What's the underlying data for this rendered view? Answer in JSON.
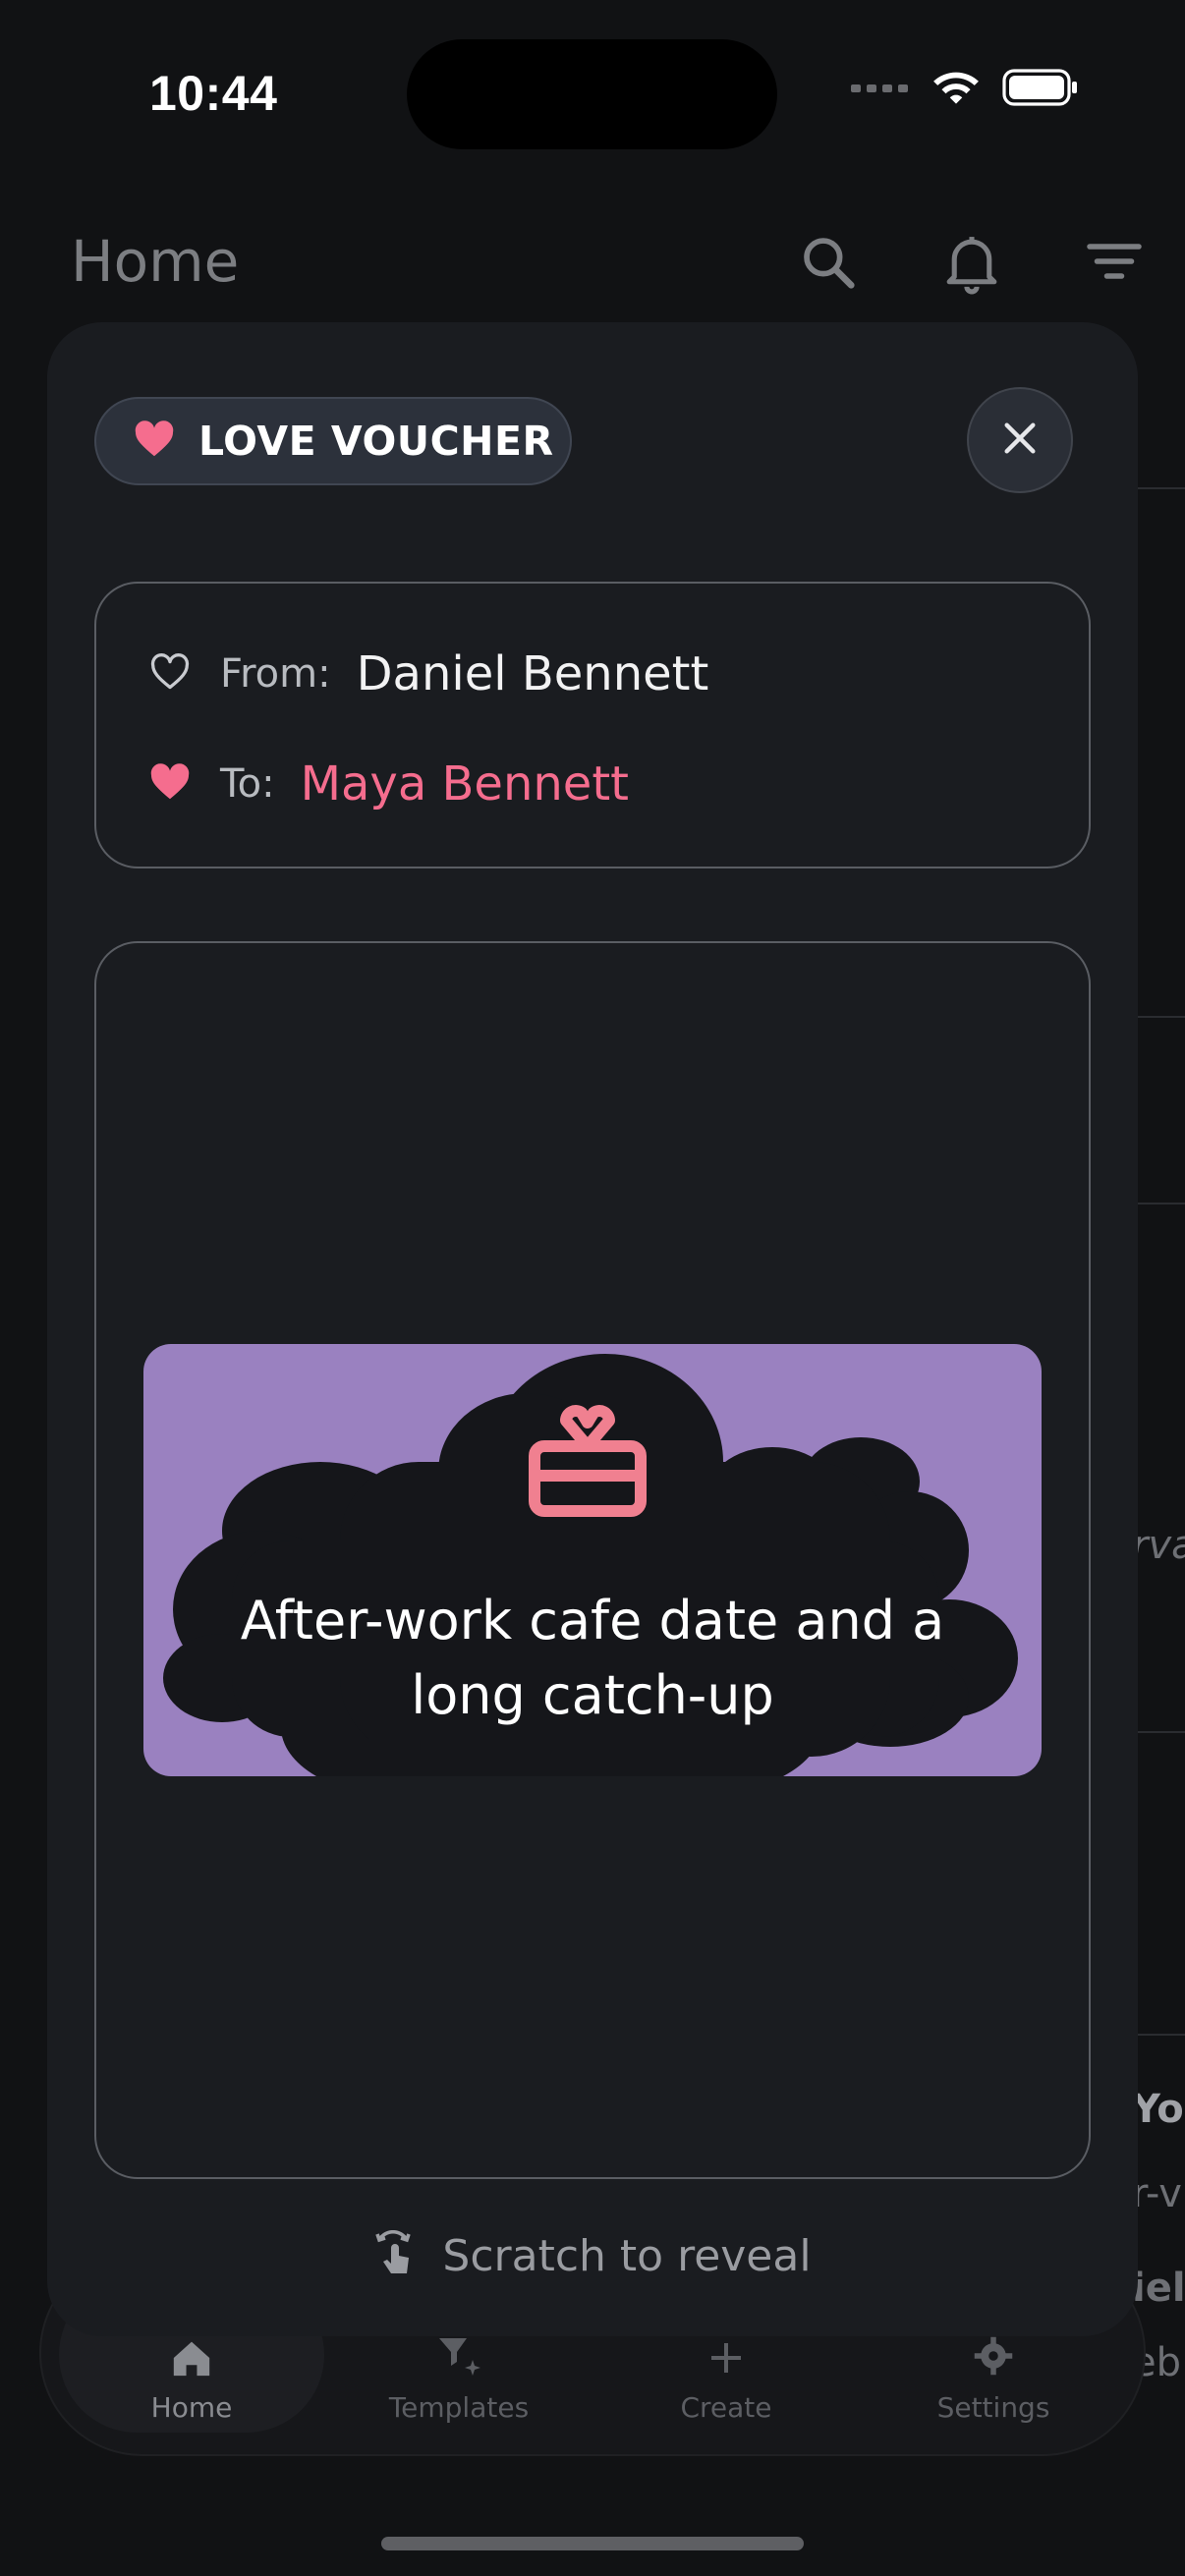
{
  "status_bar": {
    "time": "10:44"
  },
  "background": {
    "title": "Home",
    "snippets": [
      "rva",
      "Yo",
      "r-v",
      "iel",
      "eb"
    ]
  },
  "tabbar": {
    "tabs": [
      {
        "label": "Home",
        "icon": "home-icon",
        "active": true
      },
      {
        "label": "Templates",
        "icon": "templates-icon",
        "active": false
      },
      {
        "label": "Create",
        "icon": "plus-icon",
        "active": false
      },
      {
        "label": "Settings",
        "icon": "gear-icon",
        "active": false
      }
    ]
  },
  "voucher": {
    "badge": "LOVE VOUCHER",
    "from_label": "From:",
    "from_name": "Daniel Bennett",
    "to_label": "To:",
    "to_name": "Maya Bennett",
    "message": "After-work cafe date and a long catch-up",
    "hint": "Scratch to reveal"
  },
  "colors": {
    "accent_pink": "#f56d8e",
    "voucher_purple": "#9a81c0",
    "sheet_bg": "#1a1c20"
  }
}
